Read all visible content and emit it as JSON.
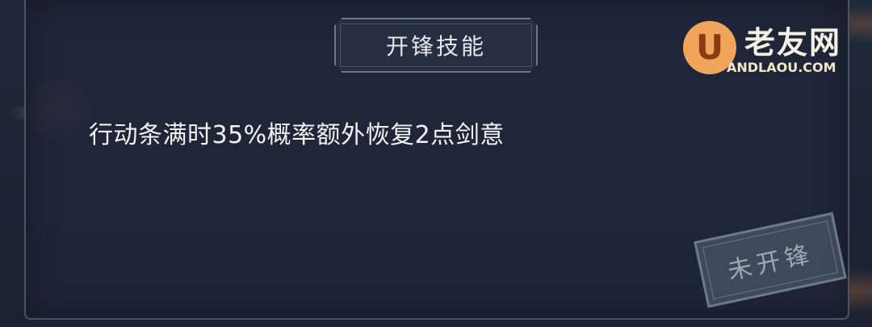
{
  "skill_panel": {
    "title": "开锋技能",
    "description": "行动条满时35%概率额外恢复2点剑意",
    "status_stamp": "未开锋"
  },
  "watermark": {
    "badge": "U",
    "site_name": "老友网",
    "domain": "ANDLAOU.COM"
  }
}
